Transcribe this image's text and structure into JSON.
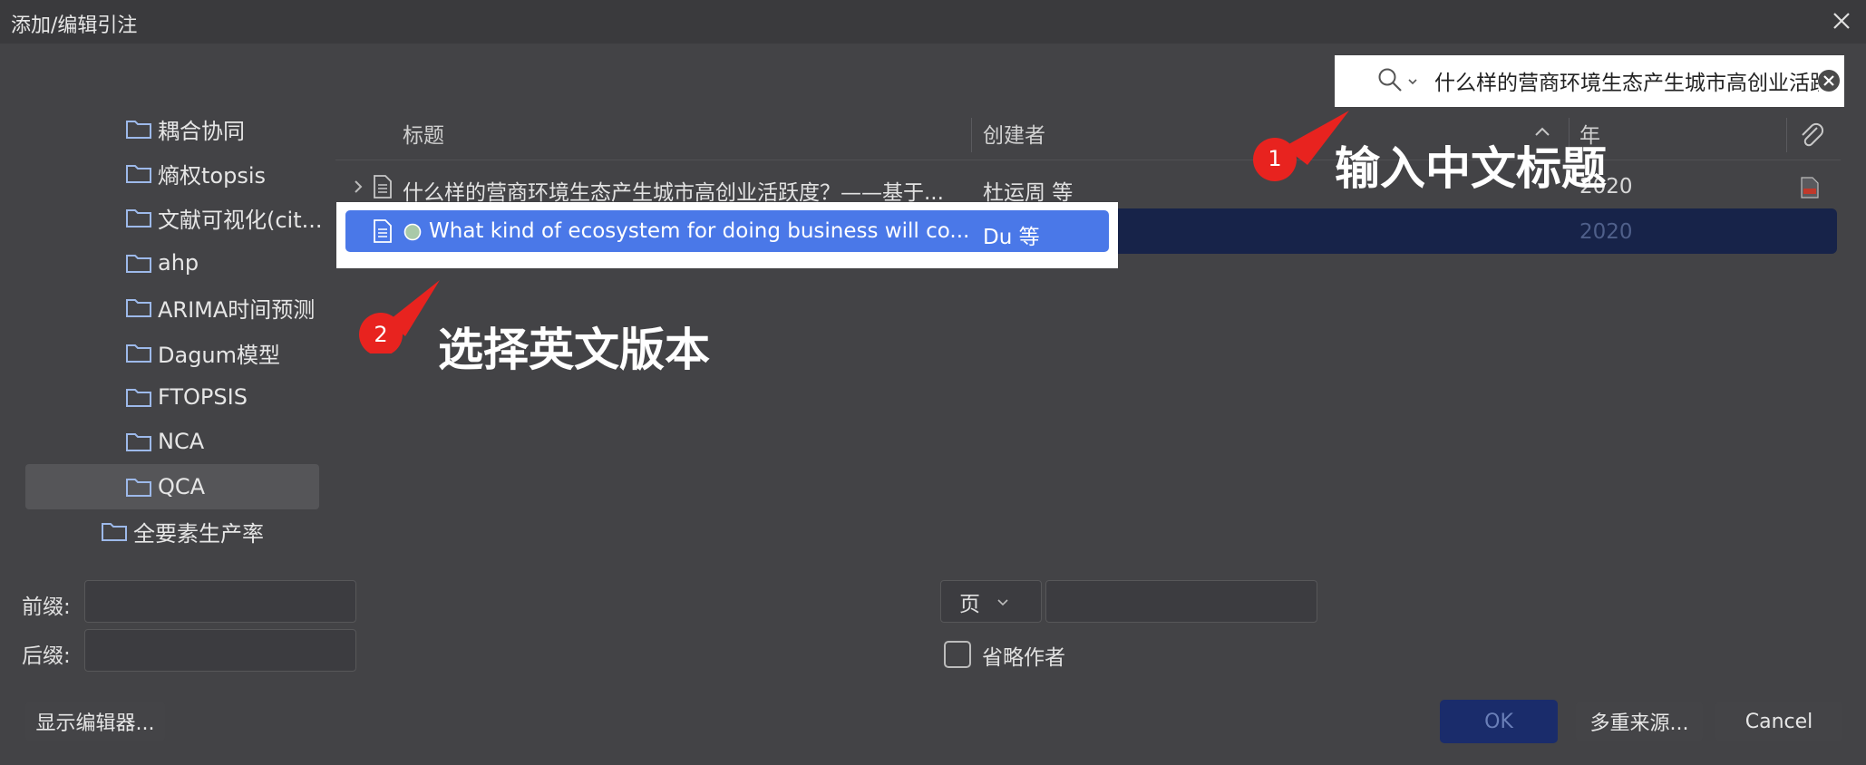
{
  "window": {
    "title": "添加/编辑引注"
  },
  "folders": [
    {
      "label": "耦合协同"
    },
    {
      "label": "熵权topsis"
    },
    {
      "label": "文献可视化(cit..."
    },
    {
      "label": "ahp"
    },
    {
      "label": "ARIMA时间预测"
    },
    {
      "label": "Dagum模型"
    },
    {
      "label": "FTOPSIS"
    },
    {
      "label": "NCA"
    },
    {
      "label": "QCA"
    },
    {
      "label": "全要素生产率"
    }
  ],
  "search": {
    "value": "什么样的营商环境生态产生城市高创业活跃"
  },
  "table": {
    "headers": {
      "title": "标题",
      "creator": "创建者",
      "year": "年"
    },
    "rows": [
      {
        "title": "什么样的营商环境生态产生城市高创业活跃度？——基于...",
        "creator": "杜运周 等",
        "year": "2020"
      },
      {
        "title": "What kind of ecosystem for doing business will co...",
        "creator": "Du 等",
        "year": "2020"
      }
    ]
  },
  "annotations": {
    "step1_number": "1",
    "step1_text": "输入中文标题",
    "step2_number": "2",
    "step2_text": "选择英文版本"
  },
  "form": {
    "prefix_label": "前缀:",
    "suffix_label": "后缀:",
    "locator_select": "页",
    "omit_author_label": "省略作者"
  },
  "buttons": {
    "show_editor": "显示编辑器...",
    "ok": "OK",
    "multiple_sources": "多重来源...",
    "cancel": "Cancel"
  },
  "colors": {
    "background": "#434346",
    "selection_row": "#172349",
    "selection_highlight": "#4a78e8",
    "annotation_marker": "#e8231f"
  }
}
